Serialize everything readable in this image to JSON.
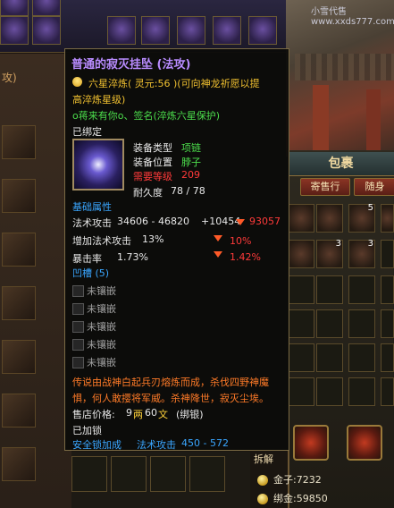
{
  "watermark": "小雪代售www.xxds777.com",
  "left_panel": {
    "top_text": "攻)"
  },
  "bag": {
    "title": "包裹",
    "buttons": [
      "寄售行",
      "随身"
    ],
    "slot_counts": [
      "5",
      "3",
      "3"
    ],
    "dismantle_label": "拆解",
    "gold_label": "金子:",
    "gold_value": "7232",
    "bound_gold_label": "绑金:",
    "bound_gold_value": "59850"
  },
  "tooltip": {
    "title": "普通的寂灭挂坠 (法攻)",
    "refine_line1": "六星淬炼( 灵元:56 )(可向神龙祈愿以提",
    "refine_line2": "高淬炼星级)",
    "signature": "o蒋来有你o、签名(淬炼六星保护)",
    "bound_status": "已绑定",
    "attrs": {
      "type_label": "装备类型",
      "type_value": "项链",
      "pos_label": "装备位置",
      "pos_value": "脖子",
      "level_label": "需要等级",
      "level_value": "209",
      "durability_label": "耐久度",
      "durability_value": "78 / 78"
    },
    "base_attr_header": "基础属性",
    "magic_attack_label": "法术攻击",
    "magic_attack_value": "34606 - 46820",
    "magic_attack_bonus": "+10454",
    "magic_attack_total": "93057",
    "extra_magic_label": "增加法术攻击",
    "extra_magic_value": "13%",
    "extra_magic_bonus": "10%",
    "crit_label": "暴击率",
    "crit_value": "1.73%",
    "crit_bonus": "1.42%",
    "sockets_header": "凹槽 (5)",
    "socket_label": "未镶嵌",
    "socket_count": 5,
    "lore_line1": "传说由战神白起兵刃熔炼而成，杀伐四野神魔",
    "lore_line2": "惧，何人敢撄将军威。杀神降世，寂灭尘埃。",
    "price_label": "售店价格:",
    "price_gold": "9",
    "price_gold_unit": "两",
    "price_coin": "60",
    "price_coin_unit": "文",
    "price_note": "(绑银)",
    "locked": "已加锁",
    "lock_bonus_label": "安全锁加成",
    "lock_bonus_attr": "法术攻击",
    "lock_bonus_value": "450 - 572"
  },
  "colors": {
    "title": "#b98cff",
    "gold": "#f0c030",
    "green": "#4cde4c",
    "red": "#ff3a3a",
    "orange": "#ff7b28",
    "blue": "#3aa6ff"
  }
}
